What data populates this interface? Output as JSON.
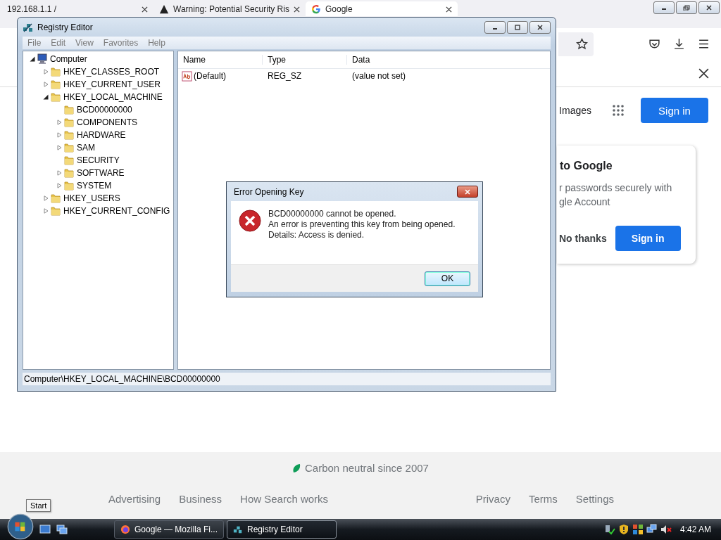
{
  "browser": {
    "tabs": [
      {
        "title": "192.168.1.1 /",
        "selected": false,
        "kind": "plain"
      },
      {
        "title": "Warning: Potential Security Ris",
        "selected": false,
        "kind": "warning"
      },
      {
        "title": "Google",
        "selected": true,
        "kind": "google"
      }
    ]
  },
  "google": {
    "header_link": "Images",
    "sign_in": "Sign in",
    "prompt": {
      "title": "to Google",
      "lines": [
        "r passwords securely with",
        "gle Account"
      ],
      "dismiss": "No thanks",
      "confirm": "Sign in"
    },
    "footer": {
      "carbon": "Carbon neutral since 2007",
      "left_links": [
        "Advertising",
        "Business",
        "How Search works"
      ],
      "right_links": [
        "Privacy",
        "Terms",
        "Settings"
      ]
    }
  },
  "registry_editor": {
    "title": "Registry Editor",
    "menu": [
      "File",
      "Edit",
      "View",
      "Favorites",
      "Help"
    ],
    "tree": [
      {
        "label": "Computer",
        "kind": "computer",
        "has_children": true,
        "expanded": true,
        "children": [
          {
            "label": "HKEY_CLASSES_ROOT",
            "kind": "folder",
            "has_children": true,
            "expanded": false
          },
          {
            "label": "HKEY_CURRENT_USER",
            "kind": "folder",
            "has_children": true,
            "expanded": false
          },
          {
            "label": "HKEY_LOCAL_MACHINE",
            "kind": "folder",
            "has_children": true,
            "expanded": true,
            "children": [
              {
                "label": "BCD00000000",
                "kind": "folder",
                "has_children": false
              },
              {
                "label": "COMPONENTS",
                "kind": "folder",
                "has_children": true,
                "expanded": false
              },
              {
                "label": "HARDWARE",
                "kind": "folder",
                "has_children": true,
                "expanded": false
              },
              {
                "label": "SAM",
                "kind": "folder",
                "has_children": true,
                "expanded": false
              },
              {
                "label": "SECURITY",
                "kind": "folder",
                "has_children": false
              },
              {
                "label": "SOFTWARE",
                "kind": "folder",
                "has_children": true,
                "expanded": false
              },
              {
                "label": "SYSTEM",
                "kind": "folder",
                "has_children": true,
                "expanded": false
              }
            ]
          },
          {
            "label": "HKEY_USERS",
            "kind": "folder",
            "has_children": true,
            "expanded": false
          },
          {
            "label": "HKEY_CURRENT_CONFIG",
            "kind": "folder",
            "has_children": true,
            "expanded": false
          }
        ]
      }
    ],
    "columns": [
      "Name",
      "Type",
      "Data"
    ],
    "rows": [
      {
        "name": "(Default)",
        "type": "REG_SZ",
        "data": "(value not set)"
      }
    ],
    "status": "Computer\\HKEY_LOCAL_MACHINE\\BCD00000000"
  },
  "error_dialog": {
    "title": "Error Opening Key",
    "lines": [
      "BCD00000000 cannot be opened.",
      "An error is preventing this key from being opened.",
      "Details: Access is denied."
    ],
    "button": "OK"
  },
  "taskbar": {
    "tooltip": "Start",
    "tasks": [
      {
        "label": "Google — Mozilla Fi...",
        "selected": false,
        "kind": "firefox"
      },
      {
        "label": "Registry Editor",
        "selected": true,
        "kind": "regedit"
      }
    ],
    "clock": "4:42 AM"
  }
}
